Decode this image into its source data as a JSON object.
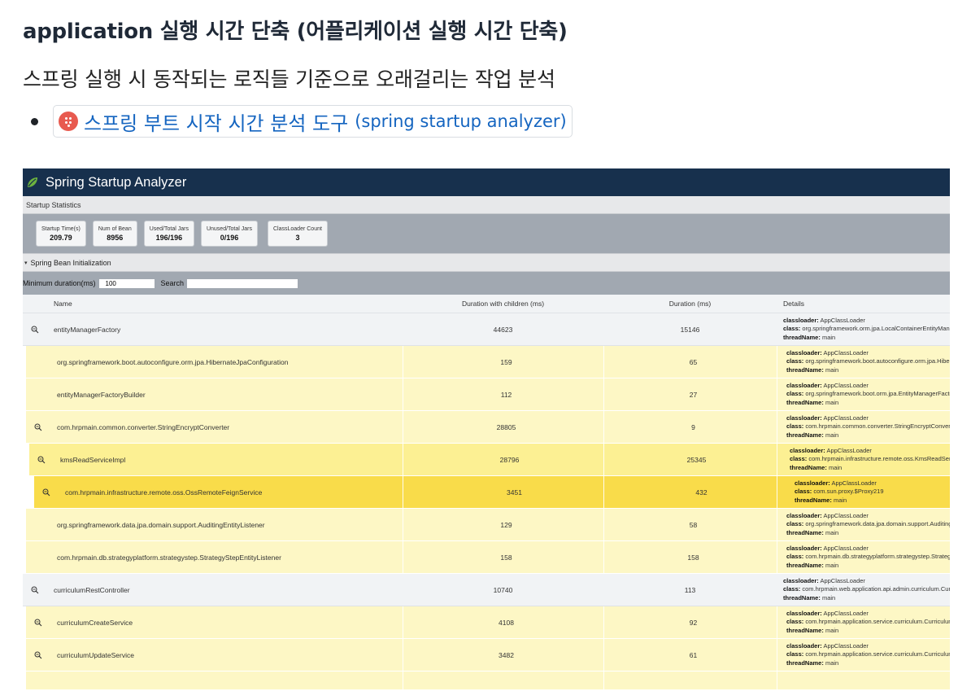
{
  "heading": "application 실행 시간 단축 (어플리케이션 실행 시간 단축)",
  "paragraph": "스프링 실행 시 동작되는 로직들 기준으로 오래걸리는 작업 분석",
  "link": {
    "title_ko": "스프링 부트 시작 시간 분석 도구",
    "title_en": "(spring startup analyzer)",
    "favicon": "dots-favicon-icon",
    "favicon_color": "#e85a4f"
  },
  "analyzer": {
    "app_title": "Spring Startup Analyzer",
    "header_color": "#17304d",
    "stats_section": "Startup Statistics",
    "stats": [
      {
        "label": "Startup Time(s)",
        "value": "209.79"
      },
      {
        "label": "Num of Bean",
        "value": "8956"
      },
      {
        "label": "Used/Total Jars",
        "value": "196/196"
      },
      {
        "label": "Unused/Total Jars",
        "value": "0/196"
      },
      {
        "label": "ClassLoader Count",
        "value": "3"
      }
    ],
    "bean_section": "Spring Bean Initialization",
    "filter": {
      "min_duration_label": "Minimum duration(ms)",
      "min_duration_value": "100",
      "search_label": "Search",
      "search_value": ""
    },
    "columns": {
      "name": "Name",
      "duration_with_children": "Duration with children (ms)",
      "duration": "Duration (ms)",
      "details": "Details"
    },
    "detail_keys": {
      "classloader": "classloader:",
      "class": "class:",
      "thread": "threadName:"
    },
    "rows": [
      {
        "name": "entityManagerFactory",
        "dwc": "44623",
        "dur": "15146",
        "classloader": "AppClassLoader",
        "class": "org.springframework.orm.jpa.LocalContainerEntityManagerFactoryBean",
        "thread": "main"
      },
      {
        "name": "org.springframework.boot.autoconfigure.orm.jpa.HibernateJpaConfiguration",
        "dwc": "159",
        "dur": "65",
        "classloader": "AppClassLoader",
        "class": "org.springframework.boot.autoconfigure.orm.jpa.HibernateJpaConfiguration",
        "thread": "main"
      },
      {
        "name": "entityManagerFactoryBuilder",
        "dwc": "112",
        "dur": "27",
        "classloader": "AppClassLoader",
        "class": "org.springframework.boot.orm.jpa.EntityManagerFactoryBuilder",
        "thread": "main"
      },
      {
        "name": "com.hrpmain.common.converter.StringEncryptConverter",
        "dwc": "28805",
        "dur": "9",
        "classloader": "AppClassLoader",
        "class": "com.hrpmain.common.converter.StringEncryptConverter",
        "thread": "main"
      },
      {
        "name": "kmsReadServiceImpl",
        "dwc": "28796",
        "dur": "25345",
        "classloader": "AppClassLoader",
        "class": "com.hrpmain.infrastructure.remote.oss.KmsReadServiceImpl",
        "thread": "main"
      },
      {
        "name": "com.hrpmain.infrastructure.remote.oss.OssRemoteFeignService",
        "dwc": "3451",
        "dur": "432",
        "classloader": "AppClassLoader",
        "class": "com.sun.proxy.$Proxy219",
        "thread": "main"
      },
      {
        "name": "org.springframework.data.jpa.domain.support.AuditingEntityListener",
        "dwc": "129",
        "dur": "58",
        "classloader": "AppClassLoader",
        "class": "org.springframework.data.jpa.domain.support.AuditingEntityListener",
        "thread": "main"
      },
      {
        "name": "com.hrpmain.db.strategyplatform.strategystep.StrategyStepEntityListener",
        "dwc": "158",
        "dur": "158",
        "classloader": "AppClassLoader",
        "class": "com.hrpmain.db.strategyplatform.strategystep.StrategyStepEntityListener",
        "thread": "main"
      },
      {
        "name": "curriculumRestController",
        "dwc": "10740",
        "dur": "113",
        "classloader": "AppClassLoader",
        "class": "com.hrpmain.web.application.api.admin.curriculum.CurriculumAdminRestController",
        "thread": "main"
      },
      {
        "name": "curriculumCreateService",
        "dwc": "4108",
        "dur": "92",
        "classloader": "AppClassLoader",
        "class": "com.hrpmain.application.service.curriculum.CurriculumCreateService",
        "thread": "main"
      },
      {
        "name": "curriculumUpdateService",
        "dwc": "3482",
        "dur": "61",
        "classloader": "AppClassLoader",
        "class": "com.hrpmain.application.service.curriculum.CurriculumUpdateService",
        "thread": "main"
      },
      {
        "name": "",
        "dwc": "",
        "dur": "",
        "classloader": "",
        "class": "",
        "thread": ""
      }
    ]
  }
}
